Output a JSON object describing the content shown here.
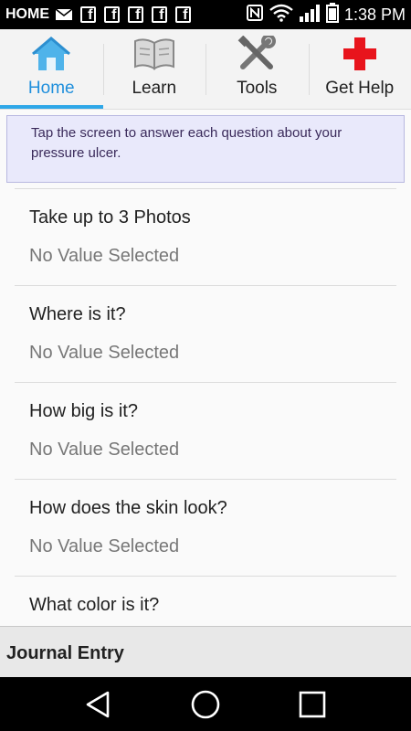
{
  "status_bar": {
    "home_label": "HOME",
    "time": "1:38 PM"
  },
  "tabs": [
    {
      "label": "Home",
      "icon": "house-icon",
      "active": true
    },
    {
      "label": "Learn",
      "icon": "book-icon",
      "active": false
    },
    {
      "label": "Tools",
      "icon": "tools-icon",
      "active": false
    },
    {
      "label": "Get Help",
      "icon": "red-cross-icon",
      "active": false
    }
  ],
  "instructions": "Tap the screen to answer each question about your pressure ulcer.",
  "questions": [
    {
      "question": "Take up to 3 Photos",
      "value": "No Value Selected"
    },
    {
      "question": "Where is it?",
      "value": "No Value Selected"
    },
    {
      "question": "How big is it?",
      "value": "No Value Selected"
    },
    {
      "question": "How does the skin look?",
      "value": "No Value Selected"
    },
    {
      "question": "What color is it?",
      "value": ""
    }
  ],
  "footer": {
    "title": "Journal Entry"
  },
  "colors": {
    "accent": "#2ea7e8",
    "instruction_bg": "#e9e9fb",
    "help_red": "#e8141c"
  }
}
